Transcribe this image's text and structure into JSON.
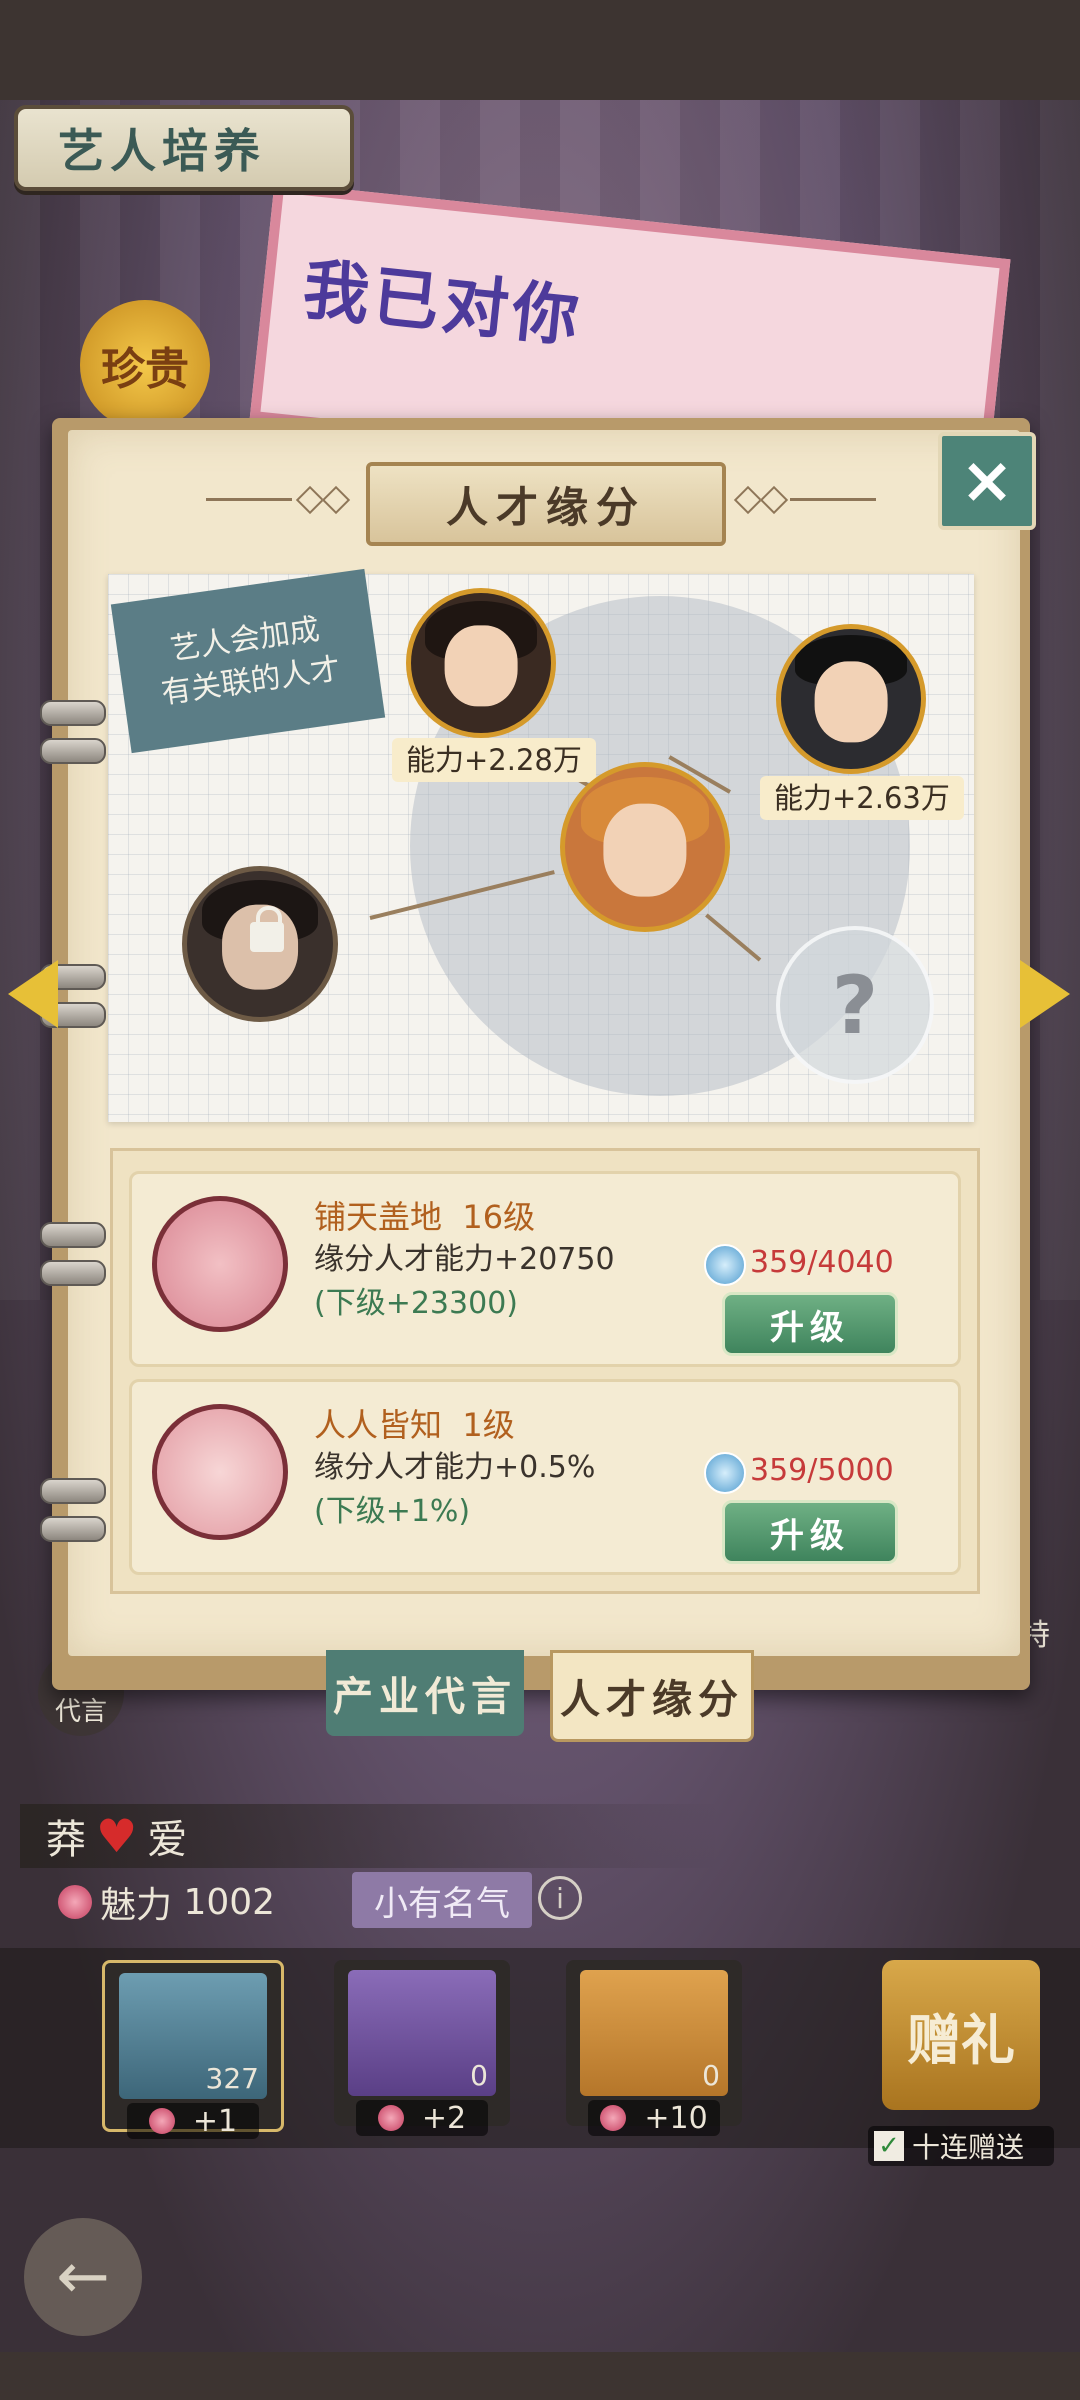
{
  "header": {
    "title": "艺人培养",
    "rare_badge": "珍贵",
    "poster_text": "我已对你"
  },
  "panel": {
    "title": "人才缘分",
    "hint": {
      "line1": "艺人会加成",
      "line2": "有关联的人才"
    },
    "power_top": "能力+2.28万",
    "power_right": "能力+2.63万",
    "mystery": "?"
  },
  "skills": [
    {
      "name": "铺天盖地",
      "level": "16级",
      "desc": "缘分人才能力+20750",
      "next": "(下级+23300)",
      "cost": "359/4040",
      "button": "升级"
    },
    {
      "name": "人人皆知",
      "level": "1级",
      "desc": "缘分人才能力+0.5%",
      "next": "(下级+1%)",
      "cost": "359/5000",
      "button": "升级"
    }
  ],
  "tabs": {
    "industry": "产业代言",
    "talent": "人才缘分"
  },
  "side": {
    "left_label": "代言",
    "right_label": "特"
  },
  "character": {
    "name_left": "莽",
    "name_right": "爱",
    "charm_label": "魅力",
    "charm_value": "1002",
    "fame": "小有名气",
    "info": "i"
  },
  "gifts": [
    {
      "count": "327",
      "charm": "+1",
      "color": "#4e7a8f"
    },
    {
      "count": "0",
      "charm": "+2",
      "color": "#6e4f9c"
    },
    {
      "count": "0",
      "charm": "+10",
      "color": "#c9893c"
    }
  ],
  "gift_button": "赠礼",
  "ten_gift": "十连赠送",
  "close_icon": "×",
  "back_icon": "←"
}
